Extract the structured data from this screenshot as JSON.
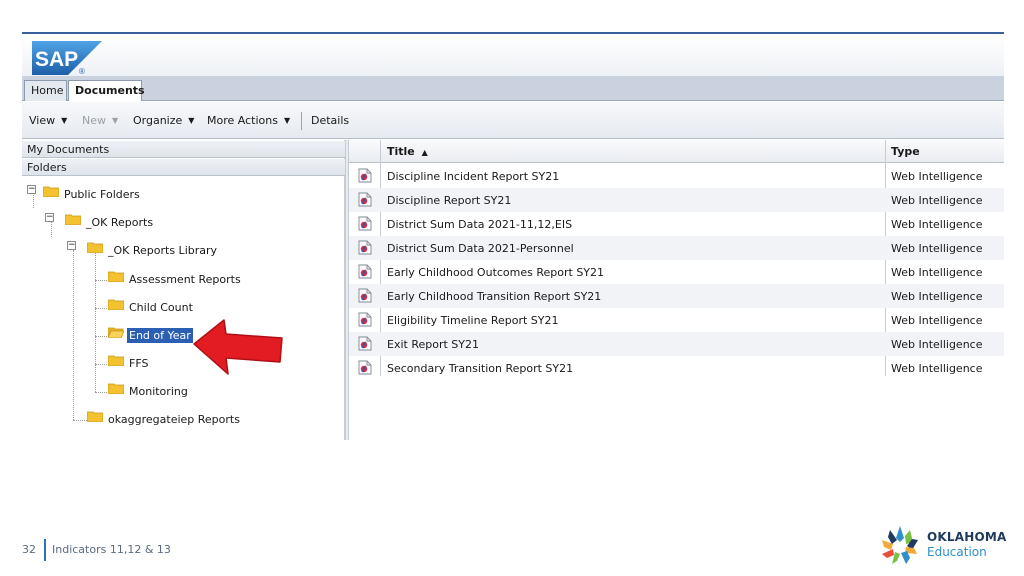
{
  "app": {
    "logo_text": "SAP",
    "registered_mark": "®"
  },
  "tabs": [
    {
      "label": "Home",
      "active": false
    },
    {
      "label": "Documents",
      "active": true
    }
  ],
  "toolbar": {
    "view_label": "View",
    "new_label": "New",
    "organize_label": "Organize",
    "more_actions_label": "More Actions",
    "details_label": "Details",
    "caret": "▼"
  },
  "left_pane": {
    "my_documents_label": "My Documents",
    "folders_label": "Folders",
    "tree": [
      {
        "label": "Public Folders",
        "expander": "−",
        "selected": false
      },
      {
        "label": "_OK Reports",
        "expander": "−",
        "selected": false
      },
      {
        "label": "_OK Reports Library",
        "expander": "−",
        "selected": false
      },
      {
        "label": "Assessment Reports",
        "expander": "",
        "selected": false
      },
      {
        "label": "Child Count",
        "expander": "",
        "selected": false
      },
      {
        "label": "End of Year",
        "expander": "",
        "selected": true
      },
      {
        "label": "FFS",
        "expander": "",
        "selected": false
      },
      {
        "label": "Monitoring",
        "expander": "",
        "selected": false
      },
      {
        "label": "okaggregateiep Reports",
        "expander": "",
        "selected": false
      }
    ]
  },
  "table": {
    "columns": [
      {
        "label": "Title",
        "sort_indicator": "▲"
      },
      {
        "label": "Type"
      }
    ],
    "rows": [
      {
        "title": "Discipline Incident Report SY21",
        "type": "Web Intelligence"
      },
      {
        "title": "Discipline Report SY21",
        "type": "Web Intelligence"
      },
      {
        "title": "District Sum Data 2021-11,12,EIS",
        "type": "Web Intelligence"
      },
      {
        "title": "District Sum Data 2021-Personnel",
        "type": "Web Intelligence"
      },
      {
        "title": "Early Childhood Outcomes Report SY21",
        "type": "Web Intelligence"
      },
      {
        "title": "Early Childhood Transition Report SY21",
        "type": "Web Intelligence"
      },
      {
        "title": "Eligibility Timeline Report SY21",
        "type": "Web Intelligence"
      },
      {
        "title": "Exit Report SY21",
        "type": "Web Intelligence"
      },
      {
        "title": "Secondary Transition Report SY21",
        "type": "Web Intelligence"
      }
    ]
  },
  "annotation": {
    "arrow_color": "#e31b23"
  },
  "footer": {
    "page_number": "32",
    "text": "Indicators 11,12 & 13",
    "org_line1": "OKLAHOMA",
    "org_line2": "Education"
  },
  "colors": {
    "sap_blue": "#1e73be",
    "selection_blue": "#2a5fb4",
    "folder_yellow": "#f2c230"
  }
}
